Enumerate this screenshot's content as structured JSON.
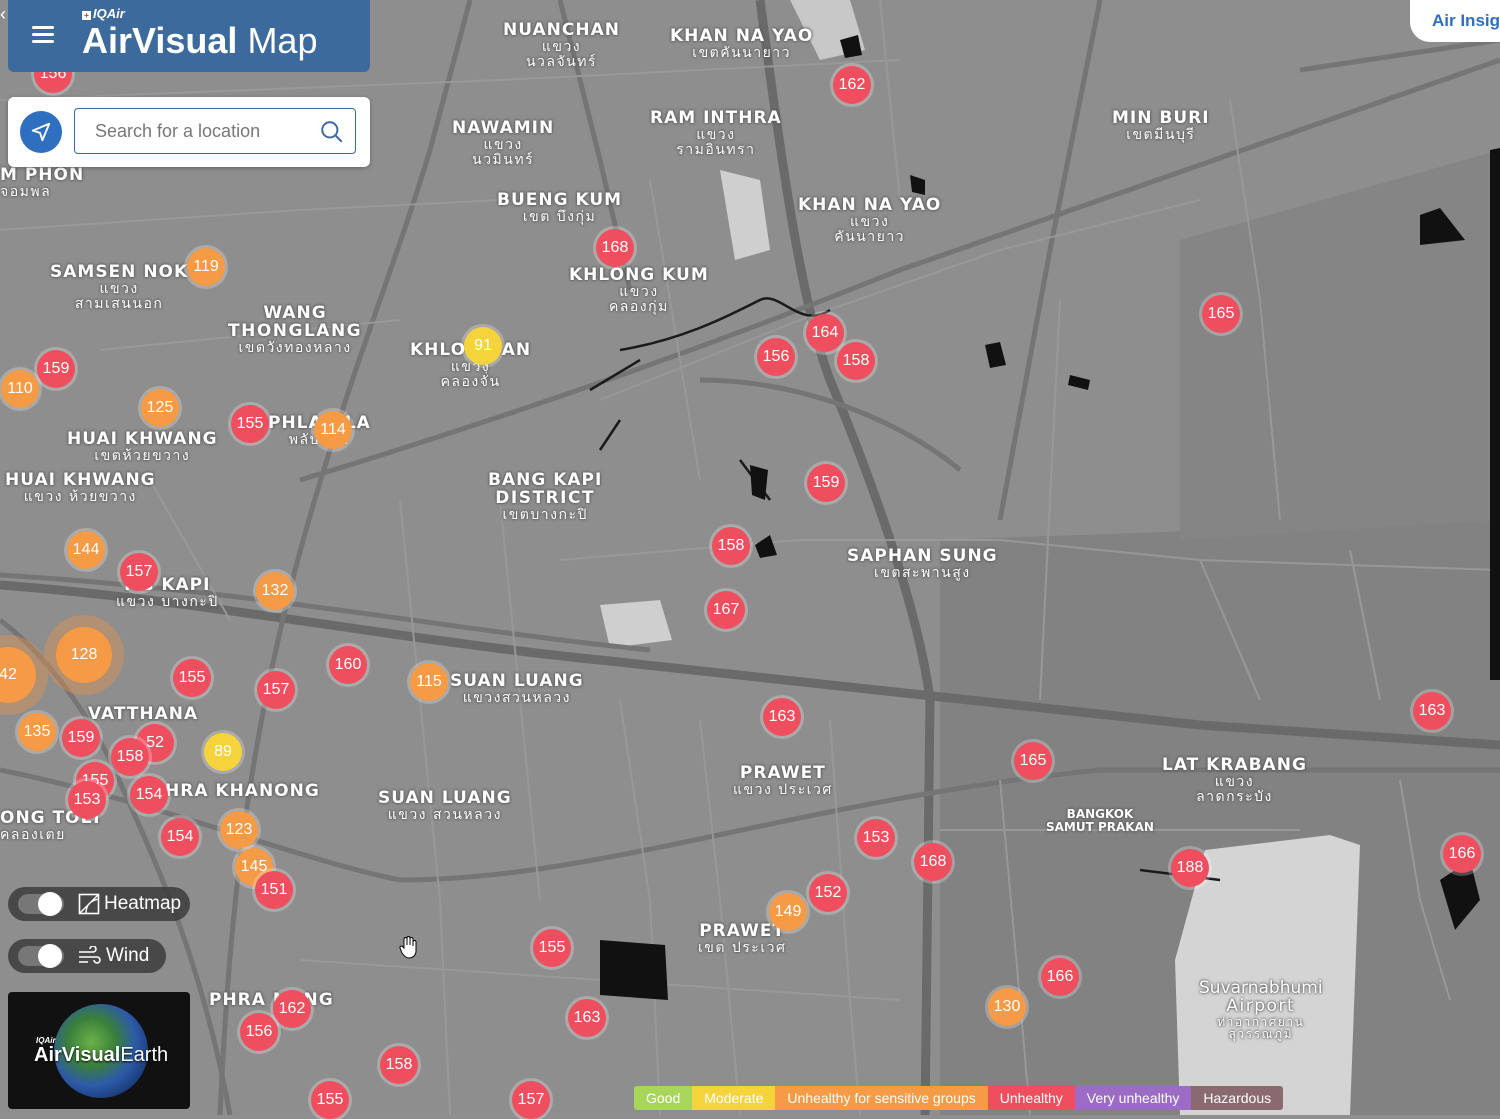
{
  "header": {
    "brand_prefix": "IQAir",
    "title_bold": "AirVisual",
    "title_light": "Map",
    "menu_icon": "hamburger-menu-icon"
  },
  "search": {
    "placeholder": "Search for a location",
    "value": ""
  },
  "top_right": {
    "insights_label": "Air Insig"
  },
  "controls": {
    "heatmap_label": "Heatmap",
    "heatmap_on": true,
    "wind_label": "Wind",
    "wind_on": true
  },
  "earth_card": {
    "brand_prefix": "IQAir",
    "title_bold": "AirVisual",
    "title_light": "Earth"
  },
  "legend": [
    {
      "label": "Good",
      "color": "#a8d65a"
    },
    {
      "label": "Moderate",
      "color": "#f5d33a"
    },
    {
      "label": "Unhealthy for sensitive groups",
      "color": "#f59a45"
    },
    {
      "label": "Unhealthy",
      "color": "#ef4e5e"
    },
    {
      "label": "Very unhealthy",
      "color": "#9b6bc5"
    },
    {
      "label": "Hazardous",
      "color": "#8a6a6e"
    }
  ],
  "aqi_colors": {
    "moderate": "#f5d33a",
    "usg": "#f59a45",
    "unhealthy": "#ef4e5e"
  },
  "place_labels": [
    {
      "name": "NUANCHAN",
      "sub": "แขวง",
      "sub2": "นวลจันทร์"
    },
    {
      "name": "KHAN NA YAO",
      "sub": "เขตคันนายาว"
    },
    {
      "name": "RAM INTHRA",
      "sub": "แขวง",
      "sub2": "รามอินทรา"
    },
    {
      "name": "NAWAMIN",
      "sub": "แขวง",
      "sub2": "นวมินทร์"
    },
    {
      "name": "MIN BURI",
      "sub": "เขตมีนบุรี"
    },
    {
      "name": "BUENG KUM",
      "sub": "เขต บึงกุ่ม"
    },
    {
      "name": "KHAN NA YAO",
      "sub": "แขวง",
      "sub2": "คันนายาว"
    },
    {
      "name": "KHLONG KUM",
      "sub": "แขวง",
      "sub2": "คลองกุ่ม"
    },
    {
      "name": "SAMSEN NOK",
      "sub": "แขวง",
      "sub2": "สามเสนนอก"
    },
    {
      "name": "WANG",
      "sub": "THONGLANG",
      "sub2": "เขตวังทองหลาง"
    },
    {
      "name": "KHLO   CHAN",
      "sub": "แขวง",
      "sub2": "คลองจั่น"
    },
    {
      "name": "M PHON",
      "sub": "จอมพล"
    },
    {
      "name": "HUAI KHWANG",
      "sub": "เขตห้วยขวาง"
    },
    {
      "name": "PHLA   HLA",
      "sub": "พลับพลา"
    },
    {
      "name": "HUAI KHWANG",
      "sub": "แขวง ห้วยขวาง"
    },
    {
      "name": "BANG KAPI",
      "sub": "DISTRICT",
      "sub2": "เขตบางกะปิ"
    },
    {
      "name": "SAPHAN SUNG",
      "sub": "เขตสะพานสูง"
    },
    {
      "name": "   NG KAPI",
      "sub": "แขวง บางกะปิ"
    },
    {
      "name": "SUAN LUANG",
      "sub": "แขวงสวนหลวง"
    },
    {
      "name": "VATTHANA",
      "sub": ""
    },
    {
      "name": "HRA KHANONG",
      "sub": ""
    },
    {
      "name": "ONG TOEI",
      "sub": "คลองเตย"
    },
    {
      "name": "SUAN LUANG",
      "sub": "แขวง สวนหลวง"
    },
    {
      "name": "PRAWET",
      "sub": "แขวง ประเวศ"
    },
    {
      "name": "LAT KRABANG",
      "sub": "แขวง",
      "sub2": "ลาดกระบัง"
    },
    {
      "name": "BANGKOK",
      "sub": "SAMUT PRAKAN"
    },
    {
      "name": "PRAWET",
      "sub": "เขต ประเวศ"
    },
    {
      "name": "PHRA   NONG",
      "sub": ""
    },
    {
      "name": "Suvarnabhumi",
      "sub": "Airport",
      "sub2": "ท่าอากาศยาน สุวรรณภูมิ"
    }
  ],
  "stations": [
    {
      "aqi": "156",
      "level": "unhealthy"
    },
    {
      "aqi": "162",
      "level": "unhealthy"
    },
    {
      "aqi": "168",
      "level": "unhealthy"
    },
    {
      "aqi": "119",
      "level": "usg"
    },
    {
      "aqi": "165",
      "level": "unhealthy"
    },
    {
      "aqi": "91",
      "level": "moderate"
    },
    {
      "aqi": "164",
      "level": "unhealthy"
    },
    {
      "aqi": "156",
      "level": "unhealthy"
    },
    {
      "aqi": "158",
      "level": "unhealthy"
    },
    {
      "aqi": "159",
      "level": "unhealthy"
    },
    {
      "aqi": "110",
      "level": "usg"
    },
    {
      "aqi": "125",
      "level": "usg"
    },
    {
      "aqi": "155",
      "level": "unhealthy"
    },
    {
      "aqi": "114",
      "level": "usg"
    },
    {
      "aqi": "159",
      "level": "unhealthy"
    },
    {
      "aqi": "158",
      "level": "unhealthy"
    },
    {
      "aqi": "144",
      "level": "usg"
    },
    {
      "aqi": "157",
      "level": "unhealthy"
    },
    {
      "aqi": "132",
      "level": "usg"
    },
    {
      "aqi": "167",
      "level": "unhealthy"
    },
    {
      "aqi": "128",
      "level": "usg"
    },
    {
      "aqi": "42",
      "level": "usg"
    },
    {
      "aqi": "160",
      "level": "unhealthy"
    },
    {
      "aqi": "155",
      "level": "unhealthy"
    },
    {
      "aqi": "157",
      "level": "unhealthy"
    },
    {
      "aqi": "115",
      "level": "usg"
    },
    {
      "aqi": "163",
      "level": "unhealthy"
    },
    {
      "aqi": "163",
      "level": "unhealthy"
    },
    {
      "aqi": "135",
      "level": "usg"
    },
    {
      "aqi": "159",
      "level": "unhealthy"
    },
    {
      "aqi": "52",
      "level": "unhealthy"
    },
    {
      "aqi": "158",
      "level": "unhealthy"
    },
    {
      "aqi": "89",
      "level": "moderate"
    },
    {
      "aqi": "165",
      "level": "unhealthy"
    },
    {
      "aqi": "155",
      "level": "unhealthy"
    },
    {
      "aqi": "153",
      "level": "unhealthy"
    },
    {
      "aqi": "154",
      "level": "unhealthy"
    },
    {
      "aqi": "123",
      "level": "usg"
    },
    {
      "aqi": "154",
      "level": "unhealthy"
    },
    {
      "aqi": "153",
      "level": "unhealthy"
    },
    {
      "aqi": "168",
      "level": "unhealthy"
    },
    {
      "aqi": "188",
      "level": "unhealthy"
    },
    {
      "aqi": "166",
      "level": "unhealthy"
    },
    {
      "aqi": "145",
      "level": "usg"
    },
    {
      "aqi": "151",
      "level": "unhealthy"
    },
    {
      "aqi": "152",
      "level": "unhealthy"
    },
    {
      "aqi": "149",
      "level": "usg"
    },
    {
      "aqi": "155",
      "level": "unhealthy"
    },
    {
      "aqi": "166",
      "level": "unhealthy"
    },
    {
      "aqi": "130",
      "level": "usg"
    },
    {
      "aqi": "162",
      "level": "unhealthy"
    },
    {
      "aqi": "156",
      "level": "unhealthy"
    },
    {
      "aqi": "163",
      "level": "unhealthy"
    },
    {
      "aqi": "158",
      "level": "unhealthy"
    },
    {
      "aqi": "155",
      "level": "unhealthy"
    },
    {
      "aqi": "157",
      "level": "unhealthy"
    }
  ]
}
